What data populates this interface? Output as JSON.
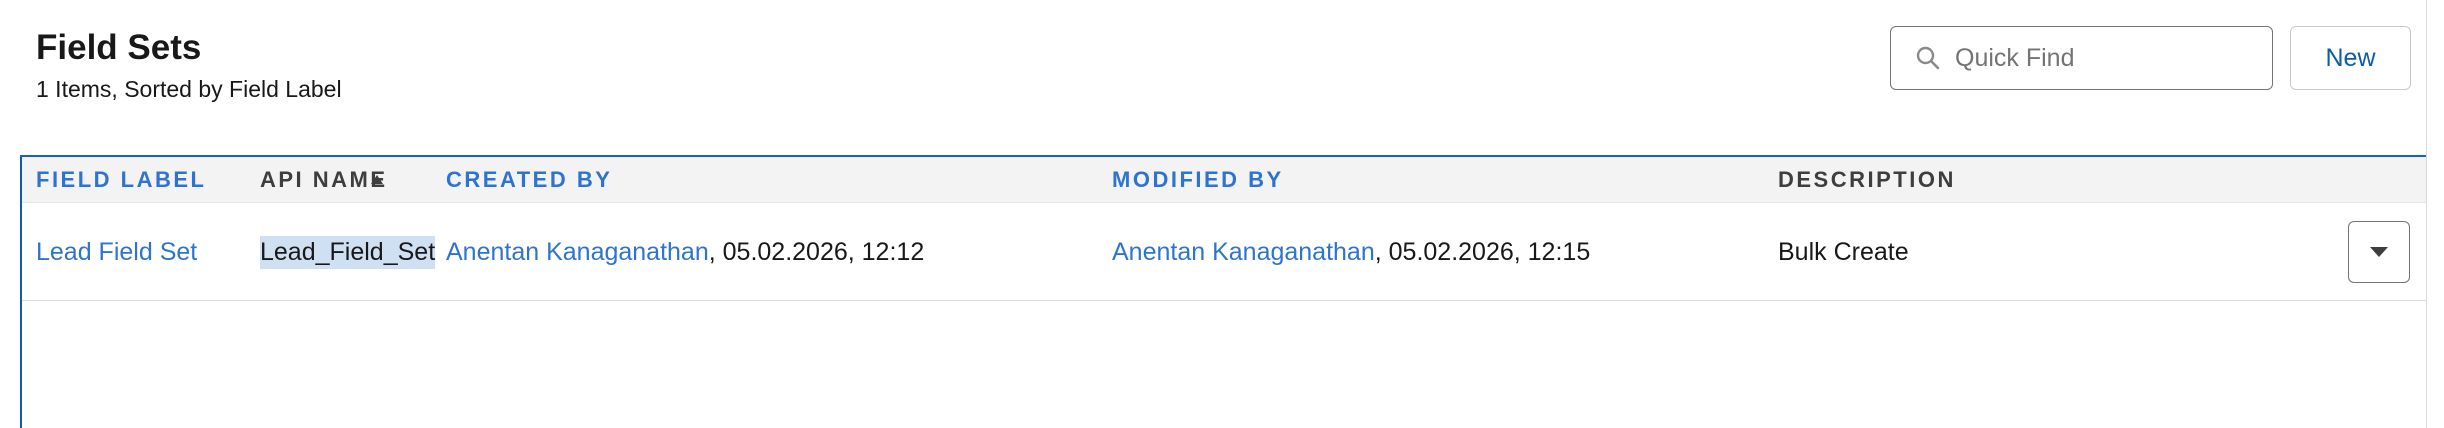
{
  "header": {
    "title": "Field Sets",
    "subtitle": "1 Items, Sorted by Field Label"
  },
  "search": {
    "placeholder": "Quick Find",
    "value": ""
  },
  "toolbar": {
    "new_label": "New"
  },
  "table": {
    "columns": [
      "FIELD LABEL",
      "API NAME",
      "CREATED BY",
      "MODIFIED BY",
      "DESCRIPTION"
    ],
    "sort": {
      "column": "FIELD LABEL",
      "direction": "ascending"
    },
    "rows": [
      {
        "field_label": "Lead Field Set",
        "api_name": "Lead_Field_Set",
        "created_by_name": "Anentan Kanaganathan",
        "created_by_date": ", 05.02.2026, 12:12",
        "modified_by_name": "Anentan Kanaganathan",
        "modified_by_date": ", 05.02.2026, 12:15",
        "description": "Bulk Create"
      }
    ]
  },
  "icons": {
    "search": "search-icon",
    "sort": "sort-ascending-icon",
    "row_menu": "chevron-down-icon"
  },
  "colors": {
    "link": "#2e74cf",
    "brand": "#0b5cab",
    "header_bg": "#f3f3f3",
    "selection": "#cfe0f2"
  }
}
